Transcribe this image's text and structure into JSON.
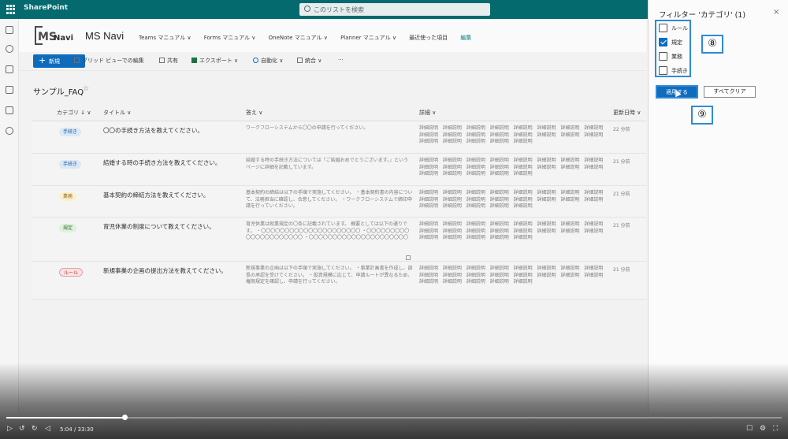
{
  "suite": {
    "app_name": "SharePoint",
    "search_placeholder": "このリストを検索"
  },
  "site": {
    "logo_text_ms": "MS",
    "logo_text_navi": "Navi",
    "title": "MS Navi",
    "nav": [
      "Teams マニュアル ∨",
      "Forms マニュアル ∨",
      "OneNote マニュアル ∨",
      "Planner マニュアル ∨",
      "最近使った項目",
      "編集"
    ]
  },
  "commands": {
    "new": "新規",
    "grid": "グリッド ビューでの編集",
    "share": "共有",
    "export": "エクスポート ∨",
    "automate": "自動化 ∨",
    "integrate": "統合 ∨",
    "more": "···"
  },
  "list": {
    "name": "サンプル_FAQ",
    "star": "☆",
    "columns": {
      "category": "カテゴリ ↓ ∨",
      "title": "タイトル ∨",
      "answer": "答え ∨",
      "detail": "詳細 ∨",
      "updated": "更新日時 ∨"
    },
    "rows": [
      {
        "category": "手続き",
        "category_kind": "te",
        "title": "〇〇の手続き方法を教えてください。",
        "answer": "ワークフローシステムから〇〇の申請を行ってください。",
        "detail": "詳細説明 詳細説明 詳細説明 詳細説明 詳細説明 詳細説明 詳細説明 詳細説明 詳細説明 詳細説明 詳細説明 詳細説明 詳細説明 詳細説明 詳細説明 詳細説明 詳細説明 詳細説明 詳細説明 詳細説明 詳細説明",
        "updated": "22 分前"
      },
      {
        "category": "手続き",
        "category_kind": "te",
        "title": "結婚する時の手続き方法を教えてください。",
        "answer": "結婚する時の手続き方法については「ご結婚おめでとうございます。」というページに詳細を記載しています。",
        "detail": "詳細説明 詳細説明 詳細説明 詳細説明 詳細説明 詳細説明 詳細説明 詳細説明 詳細説明 詳細説明 詳細説明 詳細説明 詳細説明 詳細説明 詳細説明 詳細説明 詳細説明 詳細説明 詳細説明 詳細説明 詳細説明",
        "updated": "21 分前"
      },
      {
        "category": "業務",
        "category_kind": "gy",
        "title": "基本契約の締結方法を教えてください。",
        "answer": "基本契約の締結は以下の手順で実施してください。 ・基本契約書の内容について、法務担当に確認し、合意してください。 ・ワークフローシステムで締印申請を行っていください。",
        "detail": "詳細説明 詳細説明 詳細説明 詳細説明 詳細説明 詳細説明 詳細説明 詳細説明 詳細説明 詳細説明 詳細説明 詳細説明 詳細説明 詳細説明 詳細説明 詳細説明 詳細説明 詳細説明 詳細説明 詳細説明 詳細説明",
        "updated": "21 分前"
      },
      {
        "category": "規定",
        "category_kind": "ki",
        "title": "育児休業の制度について教えてください。",
        "answer": "育児休業は就業規定の〇条に記載されています。 概要としては以下の通りです。 ・〇〇〇〇〇〇〇〇〇〇〇〇〇〇〇〇〇〇〇〇〇 ・〇〇〇〇〇〇〇〇〇〇〇〇〇〇〇〇〇〇〇〇〇 ・〇〇〇〇〇〇〇〇〇〇〇〇〇〇〇〇〇〇〇〇〇",
        "detail": "詳細説明 詳細説明 詳細説明 詳細説明 詳細説明 詳細説明 詳細説明 詳細説明 詳細説明 詳細説明 詳細説明 詳細説明 詳細説明 詳細説明 詳細説明 詳細説明 詳細説明 詳細説明 詳細説明 詳細説明 詳細説明",
        "updated": "21 分前"
      },
      {
        "category": "ルール",
        "category_kind": "ru",
        "title": "新規事業の企画の提出方法を教えてください。",
        "answer": "新規事業の企画は以下の手順で実施してください。 ・事業計画書を作成し、部長の承認を受けてください。 ・投資規模に応じて、申請ルートが異なるため、権限規定を確認し、申請を行ってください。",
        "detail": "詳細説明 詳細説明 詳細説明 詳細説明 詳細説明 詳細説明 詳細説明 詳細説明 詳細説明 詳細説明 詳細説明 詳細説明 詳細説明 詳細説明 詳細説明 詳細説明 詳細説明 詳細説明 詳細説明 詳細説明 詳細説明",
        "updated": "21 分前"
      }
    ]
  },
  "filter": {
    "title": "フィルター 'カテゴリ' (1)",
    "close": "×",
    "options": [
      {
        "label": "ルール",
        "checked": false
      },
      {
        "label": "規定",
        "checked": true
      },
      {
        "label": "業務",
        "checked": false
      },
      {
        "label": "手続き",
        "checked": false
      }
    ],
    "apply": "適用する",
    "clear": "すべてクリア",
    "badge_8": "⑧",
    "badge_9": "⑨"
  },
  "video": {
    "time": "5:04 / 33:30",
    "progress": 0.152
  }
}
